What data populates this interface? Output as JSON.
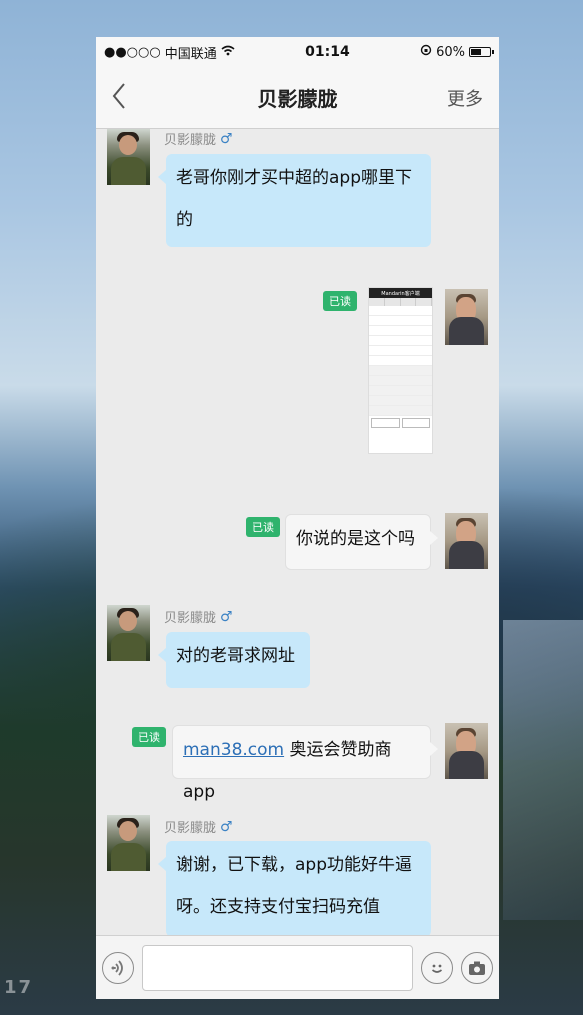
{
  "status_bar": {
    "signal": "●●○○○",
    "carrier": "中国联通",
    "wifi_icon": "wifi-icon",
    "time": "01:14",
    "battery_percent": "60%",
    "battery_level": 0.6
  },
  "nav": {
    "back_icon": "chevron-left-icon",
    "title": "贝影朦胧",
    "more_label": "更多"
  },
  "contact": {
    "name": "贝影朦胧",
    "gender_symbol": "♂"
  },
  "messages": [
    {
      "from": "them",
      "text_line1": "老哥你刚才买中超的app哪里下",
      "text_line2": "的"
    },
    {
      "from": "me",
      "type": "image",
      "read": "已读",
      "image_title": "Mandarin客户端"
    },
    {
      "from": "me",
      "text": "你说的是这个吗",
      "read": "已读"
    },
    {
      "from": "them",
      "text": "对的老哥求网址"
    },
    {
      "from": "me",
      "link": "man38.com",
      "text": " 奥运会赞助商app",
      "read": "已读"
    },
    {
      "from": "them",
      "text_line1": "谢谢，已下载，app功能好牛逼",
      "text_line2": "呀。还支持支付宝扫码充值"
    }
  ],
  "input_bar": {
    "voice_icon": "voice-icon",
    "emoji_icon": "emoji-icon",
    "camera_icon": "camera-icon"
  },
  "watermark": "17"
}
